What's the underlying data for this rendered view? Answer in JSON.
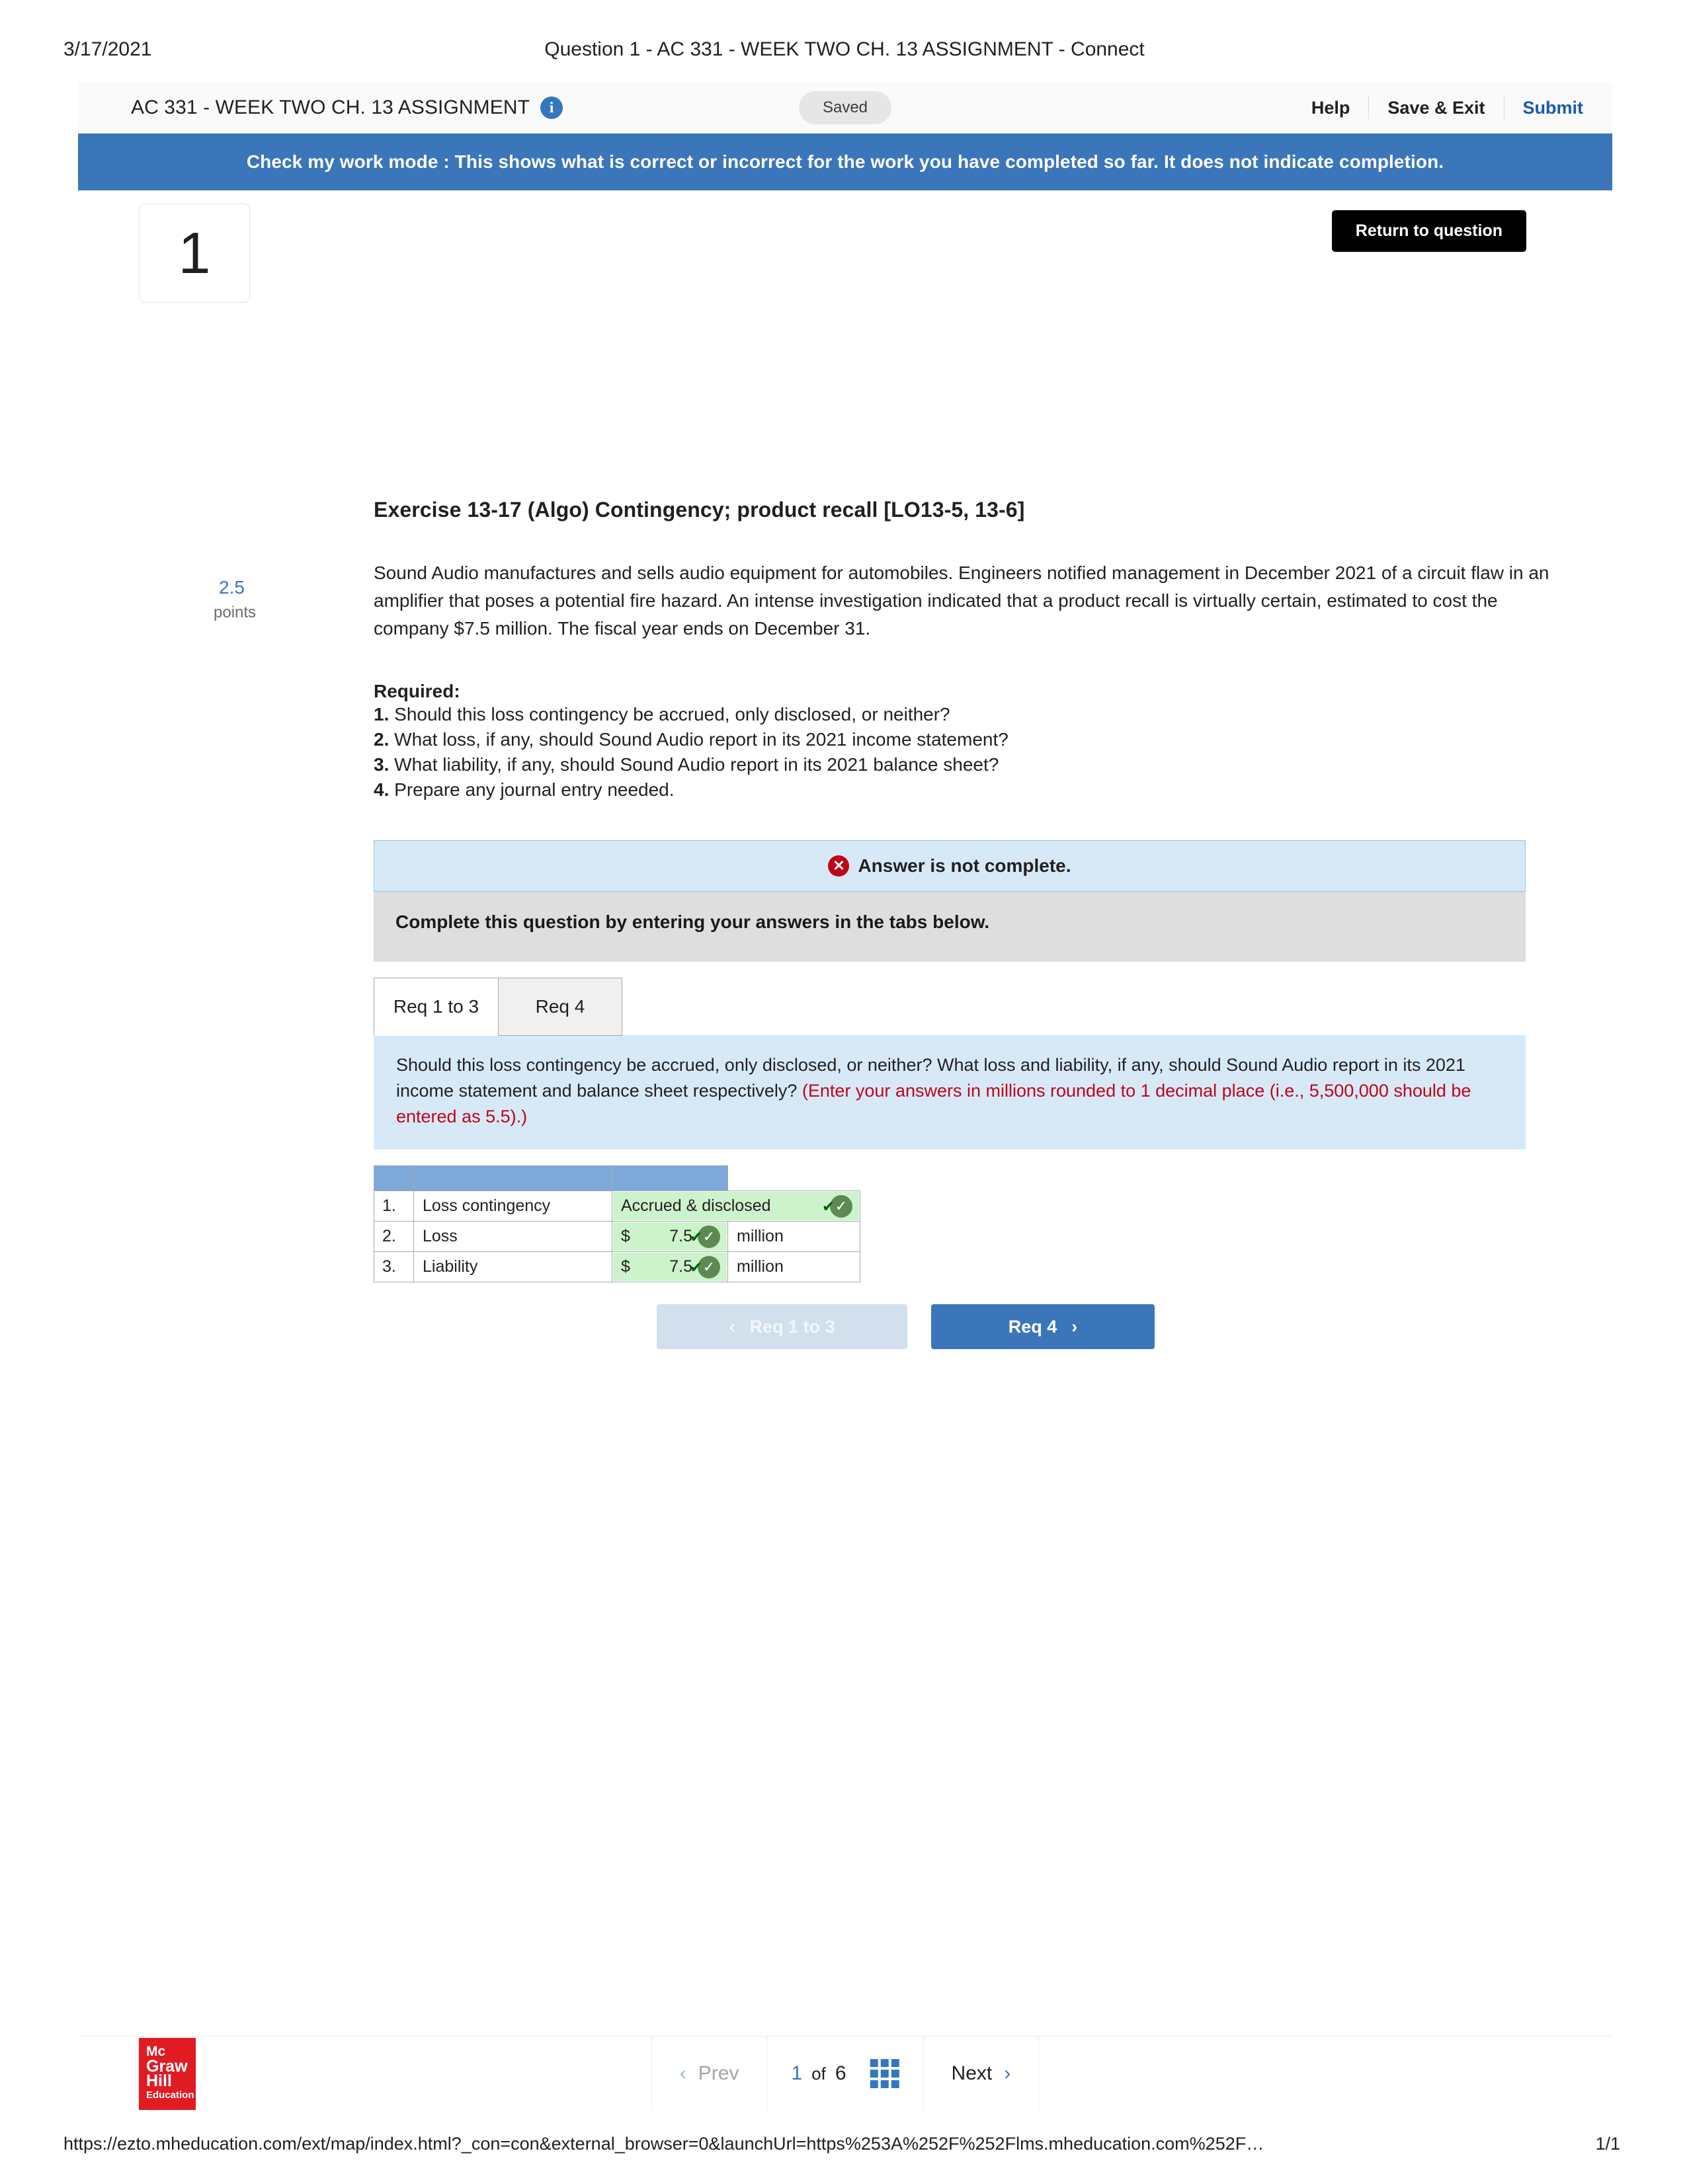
{
  "print": {
    "date": "3/17/2021",
    "title": "Question 1 - AC 331 - WEEK TWO CH. 13 ASSIGNMENT - Connect",
    "url": "https://ezto.mheducation.com/ext/map/index.html?_con=con&external_browser=0&launchUrl=https%253A%252F%252Flms.mheducation.com%252F…",
    "page_number": "1/1"
  },
  "appbar": {
    "assignment_title": "AC 331 - WEEK TWO CH. 13 ASSIGNMENT",
    "info_icon": "i",
    "saved_badge": "Saved",
    "help_label": "Help",
    "save_exit_label": "Save & Exit",
    "submit_label": "Submit"
  },
  "banner": {
    "check_my_work": "Check my work mode : This shows what is correct or incorrect for the work you have completed so far. It does not indicate completion."
  },
  "question": {
    "number": "1",
    "points_value": "2.5",
    "points_label": "points",
    "return_button": "Return to question",
    "exercise_title": "Exercise 13-17 (Algo) Contingency; product recall [LO13-5, 13-6]",
    "body": "Sound Audio manufactures and sells audio equipment for automobiles. Engineers notified management in December 2021 of a circuit flaw in an amplifier that poses a potential fire hazard. An intense investigation indicated that a product recall is virtually certain, estimated to cost the company $7.5 million. The fiscal year ends on December 31.",
    "required_heading": "Required:",
    "required_items": [
      {
        "num": "1.",
        "text": "Should this loss contingency be accrued, only disclosed, or neither?"
      },
      {
        "num": "2.",
        "text": "What loss, if any, should Sound Audio report in its 2021 income statement?"
      },
      {
        "num": "3.",
        "text": "What liability, if any, should Sound Audio report in its 2021 balance sheet?"
      },
      {
        "num": "4.",
        "text": "Prepare any journal entry needed."
      }
    ]
  },
  "status": {
    "answer_status": "Answer is not complete.",
    "status_icon": "x",
    "complete_instruction": "Complete this question by entering your answers in the tabs below."
  },
  "tabs": [
    {
      "label": "Req 1 to 3",
      "active": true
    },
    {
      "label": "Req 4",
      "active": false
    }
  ],
  "prompt": {
    "text": "Should this loss contingency be accrued, only disclosed, or neither? What loss and liability, if any, should Sound Audio report in its 2021 income statement and balance sheet respectively?",
    "red_note": "(Enter your answers in millions rounded to 1 decimal place (i.e., 5,500,000 should be entered as 5.5).)"
  },
  "answer_table": {
    "header_blank": "",
    "rows": [
      {
        "num": "1.",
        "label": "Loss contingency",
        "currency": "",
        "value": "Accrued & disclosed",
        "unit": "",
        "correct": true,
        "text_answer": true
      },
      {
        "num": "2.",
        "label": "Loss",
        "currency": "$",
        "value": "7.5",
        "unit": "million",
        "correct": true,
        "text_answer": false
      },
      {
        "num": "3.",
        "label": "Liability",
        "currency": "$",
        "value": "7.5",
        "unit": "million",
        "correct": true,
        "text_answer": false
      }
    ]
  },
  "nav": {
    "prev_label": "Req 1 to 3",
    "next_label": "Req 4",
    "prev_chevron": "‹",
    "next_chevron": "›"
  },
  "footer": {
    "logo_line1": "Mc",
    "logo_line2": "Graw",
    "logo_line3": "Hill",
    "logo_line4": "Education",
    "prev_label": "Prev",
    "next_label": "Next",
    "prev_chevron": "‹",
    "next_chevron": "›",
    "current_page": "1",
    "of_label": "of",
    "total_pages": "6"
  },
  "colors": {
    "banner_blue": "#3b76bb",
    "accent_blue": "#3577be",
    "status_blue": "#d7e9f7",
    "table_header_blue": "#7fa9db",
    "answer_green": "#ccf3cc",
    "check_green": "#5d8a52",
    "error_red": "#c00418",
    "logo_red": "#e01b22"
  }
}
